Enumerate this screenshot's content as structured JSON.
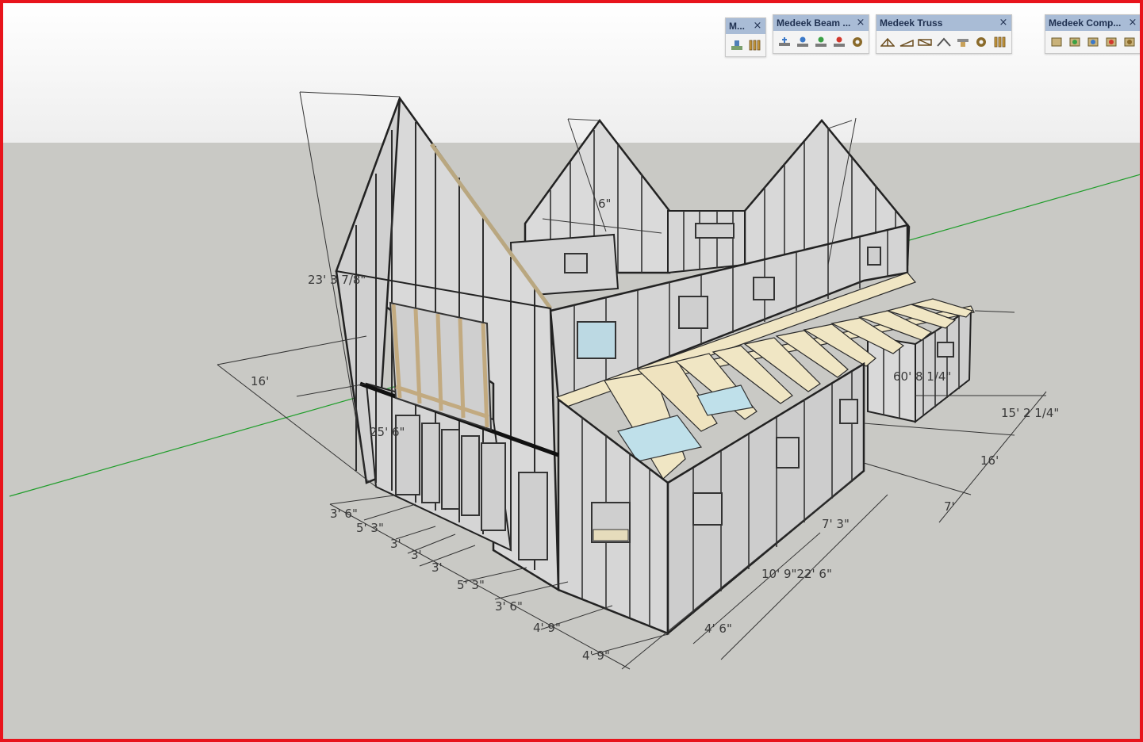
{
  "toolbars": [
    {
      "title": "M...",
      "icons": [
        "wall-tool-icon",
        "stud-framing-icon"
      ]
    },
    {
      "title": "Medeek Beam ...",
      "icons": [
        "beam-add-icon",
        "beam-edit-icon",
        "beam-move-icon",
        "beam-delete-icon",
        "beam-settings-icon"
      ]
    },
    {
      "title": "Medeek Truss",
      "icons": [
        "common-truss-icon",
        "mono-truss-icon",
        "flat-truss-icon",
        "gable-roof-icon",
        "rafter-icon",
        "truss-settings-icon",
        "truss-framing-icon"
      ]
    },
    {
      "title": "Medeek Comp...",
      "icons": [
        "component-add-icon",
        "component-edit-icon",
        "component-move-icon",
        "component-delete-icon",
        "component-settings-icon"
      ]
    }
  ],
  "close_glyph": "×",
  "dimensions": {
    "overall_height": "23' 3 7/8\"",
    "side_width": "16'",
    "inner_height": "25' 6\"",
    "gable_offset": "6\"",
    "d_3_6_a": "3' 6\"",
    "d_5_3_a": "5' 3\"",
    "d_3_a": "3'",
    "d_3_b": "3'",
    "d_3_c": "3'",
    "d_5_3_b": "5' 3\"",
    "d_3_6_b": "3' 6\"",
    "d_4_9_a": "4' 9\"",
    "d_4_9_b": "4' 9\"",
    "d_7_3": "7' 3\"",
    "d_10_9_22_6": "10' 9\"22' 6\"",
    "d_4_6": "4' 6\"",
    "d_60_8": "60' 8 1/4\"",
    "d_15_2": "15' 2 1/4\"",
    "d_16_right": "16'",
    "d_7": "7'"
  }
}
